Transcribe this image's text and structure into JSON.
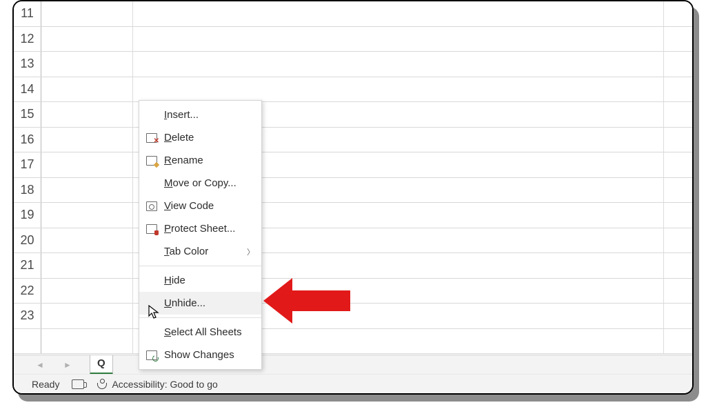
{
  "rows": [
    "11",
    "12",
    "13",
    "14",
    "15",
    "16",
    "17",
    "18",
    "19",
    "20",
    "21",
    "22",
    "23"
  ],
  "sheet_tab": "Q",
  "status": {
    "ready": "Ready",
    "accessibility": "Accessibility: Good to go"
  },
  "menu": {
    "insert": "nsert...",
    "delete": "elete",
    "rename": "ename",
    "move": "ove or Copy...",
    "view_code": "iew Code",
    "protect": "rotect Sheet...",
    "tab_color": "ab Color",
    "hide": "ide",
    "unhide": "nhide...",
    "select_all": "elect All Sheets",
    "show_changes": "Show Changes"
  },
  "underlines": {
    "insert": "I",
    "delete": "D",
    "rename": "R",
    "move": "M",
    "view_code": "V",
    "protect": "P",
    "tab_color": "T",
    "hide": "H",
    "unhide": "U",
    "select_all": "S"
  }
}
